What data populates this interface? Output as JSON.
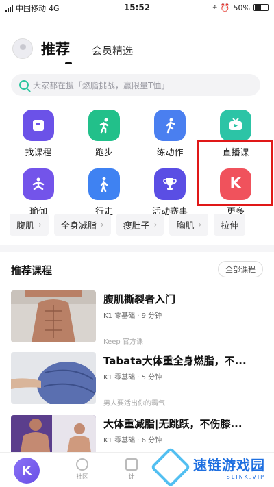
{
  "status": {
    "carrier": "中国移动",
    "network": "4G",
    "time": "15:52",
    "battery": "50%"
  },
  "header": {
    "tab_active": "推荐",
    "tab_other": "会员精选"
  },
  "search": {
    "placeholder": "大家都在搜「燃脂挑战，赢限量T恤」"
  },
  "grid": [
    {
      "label": "找课程",
      "icon": "course-icon",
      "color": "#6b52e8"
    },
    {
      "label": "跑步",
      "icon": "run-icon",
      "color": "#22c08a"
    },
    {
      "label": "练动作",
      "icon": "exercise-icon",
      "color": "#4a7ff0"
    },
    {
      "label": "直播课",
      "icon": "live-tv-icon",
      "color": "#2cc4a6"
    },
    {
      "label": "瑜伽",
      "icon": "yoga-icon",
      "color": "#7354ea"
    },
    {
      "label": "行走",
      "icon": "walk-icon",
      "color": "#3f82f2"
    },
    {
      "label": "活动赛事",
      "icon": "trophy-icon",
      "color": "#5a4ee4"
    },
    {
      "label": "更多",
      "icon": "keep-k-icon",
      "color": "#f0525c"
    }
  ],
  "chips": [
    "腹肌",
    "全身减脂",
    "瘦肚子",
    "胸肌",
    "拉伸"
  ],
  "section": {
    "title": "推荐课程",
    "all_label": "全部课程"
  },
  "courses": [
    {
      "title": "腹肌撕裂者入门",
      "meta": "K1 零基础 · 9 分钟",
      "source": "Keep 官方课"
    },
    {
      "title": "Tabata大体重全身燃脂，不...",
      "meta": "K1 零基础 · 5 分钟",
      "source": "男人要活出你的霸气"
    },
    {
      "title": "大体重减脂|无跳跃，不伤膝...",
      "meta": "K1 零基础 · 6 分钟",
      "source": ""
    }
  ],
  "tabbar": {
    "community": "社区",
    "plan": "计"
  },
  "watermark": {
    "main": "速链游戏园",
    "sub": "SLINK.VIP"
  }
}
